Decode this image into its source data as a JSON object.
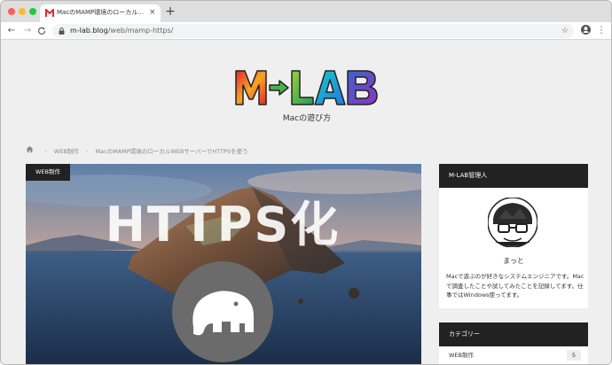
{
  "browser": {
    "tab_title": "MacのMAMP環境のローカルWEBサーバーでHTTPSを使う",
    "tab_close": "×",
    "new_tab": "+",
    "back": "←",
    "forward": "→",
    "reload": "C",
    "url_host": "m-lab.blog",
    "url_path": "/web/mamp-https/",
    "bookmark": "☆",
    "menu": "⋮"
  },
  "site": {
    "logo_text": "M-LAB",
    "tagline": "Macの遊び方"
  },
  "breadcrumb": {
    "category": "WEB制作",
    "separator": "›",
    "current": "MacのMAMP環境のローカルWEBサーバーでHTTPSを使う"
  },
  "hero": {
    "badge": "WEB制作",
    "title": "HTTPS化"
  },
  "sidebar": {
    "profile": {
      "heading": "M-LAB管理人",
      "name": "まっと",
      "bio": "Macで遊ぶのが好きなシステムエンジニアです。Macで調査したことや試してみたことを記録してます。仕事ではWindows使ってます。"
    },
    "categories": {
      "heading": "カテゴリー",
      "items": [
        {
          "label": "WEB制作",
          "count": "5"
        }
      ]
    }
  },
  "colors": {
    "header_dark": "#222222",
    "logo_M": "#e8262d",
    "logo_L": "#2fa84f",
    "logo_A": "#1e9be0",
    "logo_B": "#7a3fbf"
  }
}
